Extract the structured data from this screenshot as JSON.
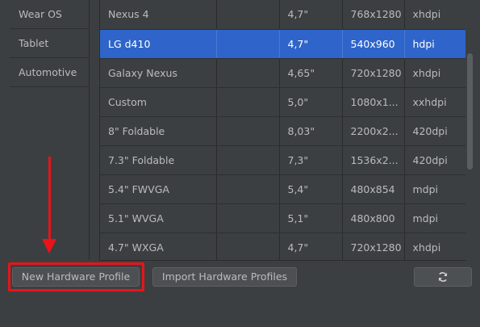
{
  "categories": [
    {
      "label": "Wear OS"
    },
    {
      "label": "Tablet"
    },
    {
      "label": "Automotive"
    }
  ],
  "devices": [
    {
      "name": "Nexus 4",
      "size": "4,7\"",
      "resolution": "768x1280",
      "density": "xhdpi"
    },
    {
      "name": "LG d410",
      "size": "4,7\"",
      "resolution": "540x960",
      "density": "hdpi",
      "selected": true
    },
    {
      "name": "Galaxy Nexus",
      "size": "4,65\"",
      "resolution": "720x1280",
      "density": "xhdpi"
    },
    {
      "name": "Custom",
      "size": "5,0\"",
      "resolution": "1080x1...",
      "density": "xxhdpi"
    },
    {
      "name": "8\" Foldable",
      "size": "8,03\"",
      "resolution": "2200x2...",
      "density": "420dpi"
    },
    {
      "name": "7.3\" Foldable",
      "size": "7,3\"",
      "resolution": "1536x2...",
      "density": "420dpi"
    },
    {
      "name": "5.4\" FWVGA",
      "size": "5,4\"",
      "resolution": "480x854",
      "density": "mdpi"
    },
    {
      "name": "5.1\" WVGA",
      "size": "5,1\"",
      "resolution": "480x800",
      "density": "mdpi"
    },
    {
      "name": "4.7\" WXGA",
      "size": "4,7\"",
      "resolution": "720x1280",
      "density": "xhdpi"
    }
  ],
  "buttons": {
    "new_profile": "New Hardware Profile",
    "import_profiles": "Import Hardware Profiles",
    "refresh_icon": "refresh-icon"
  },
  "colors": {
    "selection": "#2f65ca",
    "annotation": "#e8141a",
    "background": "#3c3f41"
  }
}
